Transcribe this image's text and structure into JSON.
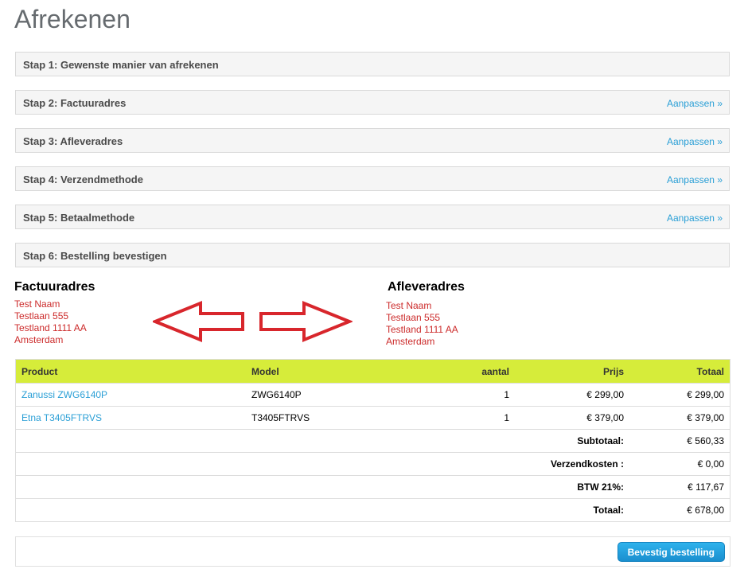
{
  "page": {
    "title": "Afrekenen"
  },
  "steps": [
    {
      "label": "Stap 1: Gewenste manier van afrekenen",
      "link": ""
    },
    {
      "label": "Stap 2: Factuuradres",
      "link": "Aanpassen »"
    },
    {
      "label": "Stap 3: Afleveradres",
      "link": "Aanpassen »"
    },
    {
      "label": "Stap 4: Verzendmethode",
      "link": "Aanpassen »"
    },
    {
      "label": "Stap 5: Betaalmethode",
      "link": "Aanpassen »"
    },
    {
      "label": "Stap 6: Bestelling bevestigen",
      "link": ""
    }
  ],
  "billing": {
    "heading": "Factuuradres",
    "lines": [
      "Test Naam",
      "Testlaan 555",
      "Testland 1111 AA",
      "Amsterdam"
    ]
  },
  "shipping": {
    "heading": "Afleveradres",
    "lines": [
      "Test Naam",
      "Testlaan 555",
      "Testland 1111 AA",
      "Amsterdam"
    ]
  },
  "cart": {
    "headers": {
      "product": "Product",
      "model": "Model",
      "qty": "aantal",
      "price": "Prijs",
      "total": "Totaal"
    },
    "rows": [
      {
        "product": "Zanussi ZWG6140P",
        "model": "ZWG6140P",
        "qty": "1",
        "price": "€ 299,00",
        "total": "€ 299,00"
      },
      {
        "product": "Etna T3405FTRVS",
        "model": "T3405FTRVS",
        "qty": "1",
        "price": "€ 379,00",
        "total": "€ 379,00"
      }
    ],
    "totals": [
      {
        "label": "Subtotaal:",
        "value": "€ 560,33"
      },
      {
        "label": "Verzendkosten :",
        "value": "€ 0,00"
      },
      {
        "label": "BTW 21%:",
        "value": "€ 117,67"
      },
      {
        "label": "Totaal:",
        "value": "€ 678,00"
      }
    ]
  },
  "confirm": {
    "button_label": "Bevestig bestelling"
  },
  "colors": {
    "accent": "#d6ec3a",
    "link": "#2a9fd6",
    "address": "#cc2a2a",
    "arrow": "#d8262c",
    "button": "#1a8fcf"
  },
  "icons": {
    "arrow_left": "arrow-left-icon",
    "arrow_right": "arrow-right-icon"
  }
}
